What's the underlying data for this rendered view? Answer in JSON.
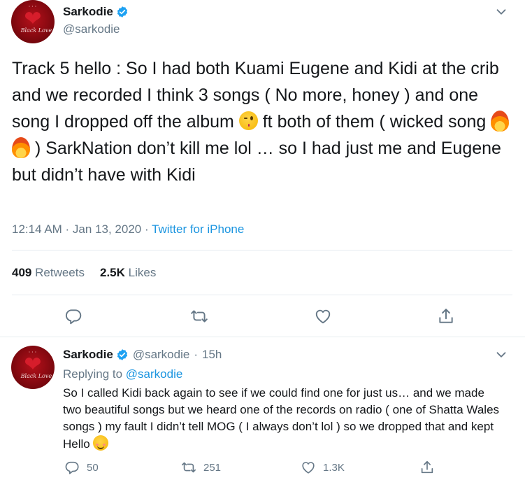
{
  "main_tweet": {
    "author": {
      "name": "Sarkodie",
      "handle": "@sarkodie",
      "verified": true,
      "avatar_label": "Black Love"
    },
    "text": {
      "line_a": "Track 5 hello : So I had both Kuami Eugene and Kidi at the crib and we recorded I think 3 songs ( No more, honey ) and one song I dropped off the album ",
      "line_b": " ft both of them ( wicked song ",
      "line_c": " ) SarkNation don’t kill me lol … so I had just me and Eugene but didn’t have with Kidi"
    },
    "timestamp": "12:14 AM · Jan 13, 2020 · ",
    "source": "Twitter for iPhone",
    "stats": {
      "retweets_count": "409",
      "retweets_label": "Retweets",
      "likes_count": "2.5K",
      "likes_label": "Likes"
    }
  },
  "reply_tweet": {
    "author": {
      "name": "Sarkodie",
      "handle": "@sarkodie",
      "age": "15h",
      "verified": true,
      "avatar_label": "Black Love"
    },
    "replying_to_label": "Replying to ",
    "replying_to_handle": "@sarkodie",
    "text": "So I called Kidi back again to see if we could find one for just us… and we made two beautiful songs but we heard one of the records on radio ( one of Shatta Wales songs ) my fault I didn’t tell MOG ( I always don’t lol ) so we dropped that and kept Hello ",
    "actions": {
      "replies": "50",
      "retweets": "251",
      "likes": "1.3K"
    }
  },
  "colors": {
    "accent": "#1b95e0",
    "secondary_text": "#657786",
    "divider": "#e6ecf0"
  },
  "icons": [
    "verified-badge-icon",
    "chevron-down-icon",
    "reply-icon",
    "retweet-icon",
    "like-icon",
    "share-icon",
    "wink-emoji-icon",
    "fire-emoji-icon",
    "blush-emoji-icon"
  ]
}
